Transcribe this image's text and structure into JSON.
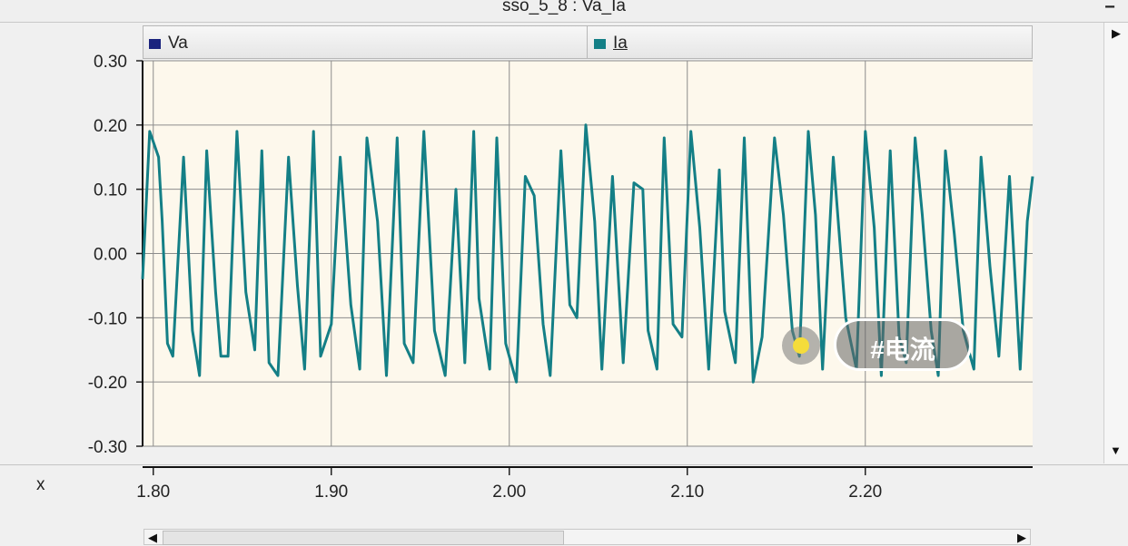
{
  "window": {
    "title": "sso_5_8 : Va_Ia",
    "minimize_label": "−"
  },
  "legend": [
    {
      "name": "Va",
      "color": "#1a237e"
    },
    {
      "name": "Ia",
      "color": "#147f86"
    }
  ],
  "axis_x_marker": "x",
  "overlay_tag": "#电流",
  "colors": {
    "plot_bg": "#fdf8ec",
    "grid": "#8c8c8c",
    "series": "#147f86"
  },
  "chart_data": {
    "type": "line",
    "title": "sso_5_8 : Va_Ia",
    "xlabel": "",
    "ylabel": "",
    "xlim": [
      1.794,
      2.294
    ],
    "ylim": [
      -0.3,
      0.3
    ],
    "xticks": [
      "1.80",
      "1.90",
      "2.00",
      "2.10",
      "2.20"
    ],
    "yticks": [
      "0.30",
      "0.20",
      "0.10",
      "0.00",
      "-0.10",
      "-0.20",
      "-0.30"
    ],
    "grid": true,
    "legend_position": "top",
    "series": [
      {
        "name": "Ia",
        "x": [
          1.794,
          1.798,
          1.803,
          1.805,
          1.808,
          1.811,
          1.817,
          1.822,
          1.826,
          1.83,
          1.835,
          1.838,
          1.842,
          1.847,
          1.852,
          1.857,
          1.861,
          1.865,
          1.87,
          1.876,
          1.881,
          1.885,
          1.89,
          1.894,
          1.9,
          1.905,
          1.911,
          1.916,
          1.92,
          1.926,
          1.931,
          1.937,
          1.941,
          1.946,
          1.952,
          1.958,
          1.964,
          1.97,
          1.975,
          1.98,
          1.983,
          1.989,
          1.993,
          1.998,
          2.004,
          2.009,
          2.014,
          2.019,
          2.023,
          2.029,
          2.034,
          2.038,
          2.043,
          2.048,
          2.052,
          2.058,
          2.064,
          2.07,
          2.075,
          2.078,
          2.083,
          2.087,
          2.092,
          2.097,
          2.102,
          2.107,
          2.112,
          2.118,
          2.121,
          2.127,
          2.132,
          2.137,
          2.142,
          2.149,
          2.154,
          2.159,
          2.163,
          2.168,
          2.172,
          2.176,
          2.182,
          2.189,
          2.195,
          2.2,
          2.205,
          2.209,
          2.214,
          2.219,
          2.223,
          2.228,
          2.232,
          2.237,
          2.241,
          2.245,
          2.25,
          2.255,
          2.261,
          2.265,
          2.27,
          2.275,
          2.281,
          2.287,
          2.291,
          2.294
        ],
        "values": [
          -0.04,
          0.19,
          0.15,
          0.05,
          -0.14,
          -0.16,
          0.15,
          -0.12,
          -0.19,
          0.16,
          -0.06,
          -0.16,
          -0.16,
          0.19,
          -0.06,
          -0.15,
          0.16,
          -0.17,
          -0.19,
          0.15,
          -0.05,
          -0.18,
          0.19,
          -0.16,
          -0.11,
          0.15,
          -0.08,
          -0.18,
          0.18,
          0.05,
          -0.19,
          0.18,
          -0.14,
          -0.17,
          0.19,
          -0.12,
          -0.19,
          0.1,
          -0.17,
          0.19,
          -0.07,
          -0.18,
          0.18,
          -0.14,
          -0.2,
          0.12,
          0.09,
          -0.11,
          -0.19,
          0.16,
          -0.08,
          -0.1,
          0.2,
          0.05,
          -0.18,
          0.12,
          -0.17,
          0.11,
          0.1,
          -0.12,
          -0.18,
          0.18,
          -0.11,
          -0.13,
          0.19,
          0.04,
          -0.18,
          0.13,
          -0.09,
          -0.17,
          0.18,
          -0.2,
          -0.13,
          0.18,
          0.06,
          -0.12,
          -0.16,
          0.19,
          0.06,
          -0.18,
          0.15,
          -0.1,
          -0.18,
          0.19,
          0.04,
          -0.19,
          0.16,
          -0.13,
          -0.17,
          0.18,
          0.06,
          -0.12,
          -0.19,
          0.16,
          0.03,
          -0.12,
          -0.18,
          0.15,
          -0.02,
          -0.16,
          0.12,
          -0.18,
          0.05,
          0.12
        ]
      }
    ]
  }
}
